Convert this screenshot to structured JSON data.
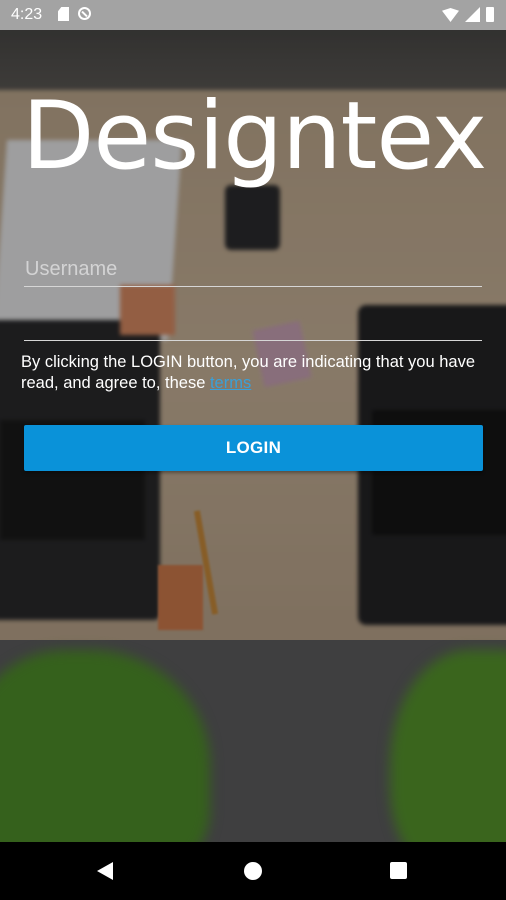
{
  "status_bar": {
    "time": "4:23",
    "icons_left": [
      "sd-card-icon",
      "do-not-disturb-icon"
    ],
    "icons_right": [
      "wifi-icon",
      "signal-icon",
      "battery-icon"
    ]
  },
  "app": {
    "logo": "Designtex"
  },
  "form": {
    "username_placeholder": "Username",
    "username_value": "",
    "password_value": "",
    "terms_text": "By clicking the LOGIN button, you are indicating that you have read, and agree to, these ",
    "terms_link": "terms",
    "login_label": "LOGIN"
  },
  "colors": {
    "accent": "#0a92d9",
    "link": "#3aa0d8",
    "status_bar": "#a3a3a3",
    "nav_bar": "#000000"
  },
  "nav_bar": {
    "buttons": [
      "back-icon",
      "home-icon",
      "recents-icon"
    ]
  }
}
